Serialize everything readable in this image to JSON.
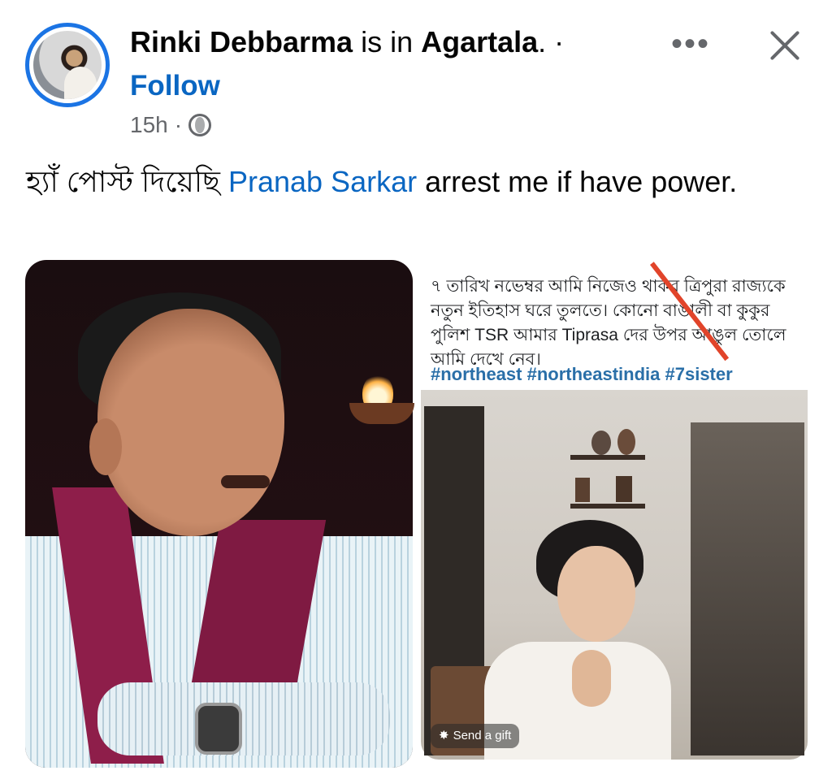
{
  "post": {
    "author": "Rinki Debbarma",
    "location_prefix": " is in ",
    "location": "Agartala",
    "location_suffix": ". ·",
    "follow_label": "Follow",
    "time": "15h",
    "time_separator": "·",
    "audience_icon": "globe-icon",
    "more_icon": "more-icon",
    "close_icon": "close-icon",
    "text_prefix": "হ্যাঁ পোস্ট দিয়েছি ",
    "mention": "Pranab Sarkar",
    "text_suffix": " arrest me if have power."
  },
  "shared_screenshot": {
    "bengali_text": "৭ তারিখ নভেম্বর আমি নিজেও থাকব ত্রিপুরা রাজ্যকে নতুন ইতিহাস ঘরে তুলতে। কোনো বাঙালী বা কুকুর পুলিশ TSR আমার Tiprasa দের উপর আঙুল তোলে আমি দেখে নেব।",
    "hashtags": "#northeast #northeastindia #7sister",
    "send_gift_label": "Send a gift"
  },
  "colors": {
    "link_blue": "#0a66c2",
    "avatar_ring": "#1b74e4",
    "meta_gray": "#65676b",
    "hashtag_blue": "#2a6fa8"
  }
}
